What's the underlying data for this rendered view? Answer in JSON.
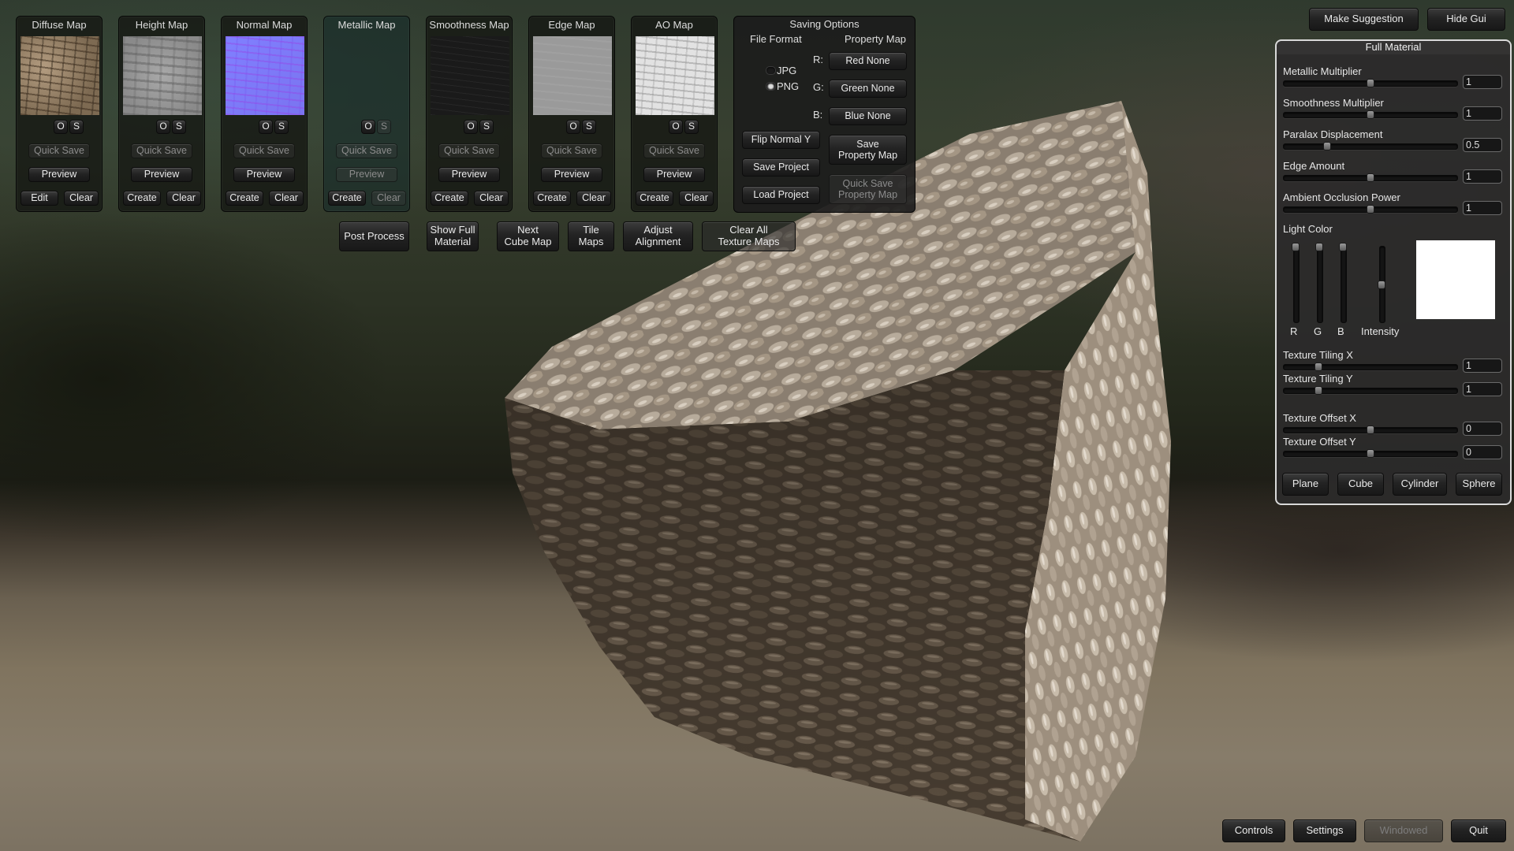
{
  "colors": {
    "light_color": "#ffffff",
    "panel_border": "#d9d9d9"
  },
  "map_panels": [
    {
      "title": "Diffuse Map",
      "texture": "diffuse",
      "open": "O",
      "save": "S",
      "save_enabled": true,
      "quick_save": "Quick Save",
      "preview": "Preview",
      "preview_enabled": true,
      "primary": "Edit",
      "clear": "Clear",
      "clear_enabled": true
    },
    {
      "title": "Height Map",
      "texture": "height",
      "open": "O",
      "save": "S",
      "save_enabled": true,
      "quick_save": "Quick Save",
      "preview": "Preview",
      "preview_enabled": true,
      "primary": "Create",
      "clear": "Clear",
      "clear_enabled": true
    },
    {
      "title": "Normal Map",
      "texture": "normal",
      "open": "O",
      "save": "S",
      "save_enabled": true,
      "quick_save": "Quick Save",
      "preview": "Preview",
      "preview_enabled": true,
      "primary": "Create",
      "clear": "Clear",
      "clear_enabled": true
    },
    {
      "title": "Metallic Map",
      "texture": "metallic",
      "open": "O",
      "save": "S",
      "save_enabled": false,
      "quick_save": "Quick Save",
      "preview": "Preview",
      "preview_enabled": false,
      "primary": "Create",
      "clear": "Clear",
      "clear_enabled": false
    },
    {
      "title": "Smoothness Map",
      "texture": "smooth",
      "open": "O",
      "save": "S",
      "save_enabled": true,
      "quick_save": "Quick Save",
      "preview": "Preview",
      "preview_enabled": true,
      "primary": "Create",
      "clear": "Clear",
      "clear_enabled": true
    },
    {
      "title": "Edge Map",
      "texture": "edge",
      "open": "O",
      "save": "S",
      "save_enabled": true,
      "quick_save": "Quick Save",
      "preview": "Preview",
      "preview_enabled": true,
      "primary": "Create",
      "clear": "Clear",
      "clear_enabled": true
    },
    {
      "title": "AO Map",
      "texture": "ao",
      "open": "O",
      "save": "S",
      "save_enabled": true,
      "quick_save": "Quick Save",
      "preview": "Preview",
      "preview_enabled": true,
      "primary": "Create",
      "clear": "Clear",
      "clear_enabled": true
    }
  ],
  "saving_options": {
    "title": "Saving Options",
    "file_format_label": "File Format",
    "formats": [
      {
        "label": "JPG",
        "selected": false
      },
      {
        "label": "PNG",
        "selected": true
      }
    ],
    "property_map_label": "Property Map",
    "channels": [
      {
        "label": "R:",
        "value": "Red None"
      },
      {
        "label": "G:",
        "value": "Green None"
      },
      {
        "label": "B:",
        "value": "Blue None"
      }
    ],
    "flip_normal": "Flip Normal Y",
    "save_project": "Save Project",
    "load_project": "Load Project",
    "save_property_map": "Save\nProperty Map",
    "quick_save_property_map": "Quick Save\nProperty Map"
  },
  "toolbar": {
    "post_process": "Post Process",
    "show_full_material": "Show Full\nMaterial",
    "next_cube_map": "Next\nCube Map",
    "tile_maps": "Tile\nMaps",
    "adjust_alignment": "Adjust\nAlignment",
    "clear_all": "Clear All\nTexture Maps"
  },
  "top_right": {
    "make_suggestion": "Make Suggestion",
    "hide_gui": "Hide Gui"
  },
  "material": {
    "title": "Full Material",
    "sliders": [
      {
        "label": "Metallic Multiplier",
        "value": "1",
        "fraction": 0.5
      },
      {
        "label": "Smoothness Multiplier",
        "value": "1",
        "fraction": 0.5
      },
      {
        "label": "Paralax Displacement",
        "value": "0.5",
        "fraction": 0.25
      },
      {
        "label": "Edge Amount",
        "value": "1",
        "fraction": 0.5
      },
      {
        "label": "Ambient Occlusion Power",
        "value": "1",
        "fraction": 0.5
      }
    ],
    "light_color_label": "Light Color",
    "light_channels": [
      {
        "label": "R",
        "value": 1.0
      },
      {
        "label": "G",
        "value": 1.0
      },
      {
        "label": "B",
        "value": 1.0
      },
      {
        "label": "Intensity",
        "value": 0.5
      }
    ],
    "tiling": [
      {
        "label": "Texture Tiling X",
        "value": "1",
        "fraction": 0.2
      },
      {
        "label": "Texture Tiling Y",
        "value": "1",
        "fraction": 0.2
      }
    ],
    "offset": [
      {
        "label": "Texture Offset X",
        "value": "0",
        "fraction": 0.5
      },
      {
        "label": "Texture Offset Y",
        "value": "0",
        "fraction": 0.5
      }
    ],
    "shapes": [
      "Plane",
      "Cube",
      "Cylinder",
      "Sphere"
    ]
  },
  "bottom_bar": {
    "controls": "Controls",
    "settings": "Settings",
    "windowed": "Windowed",
    "quit": "Quit"
  }
}
